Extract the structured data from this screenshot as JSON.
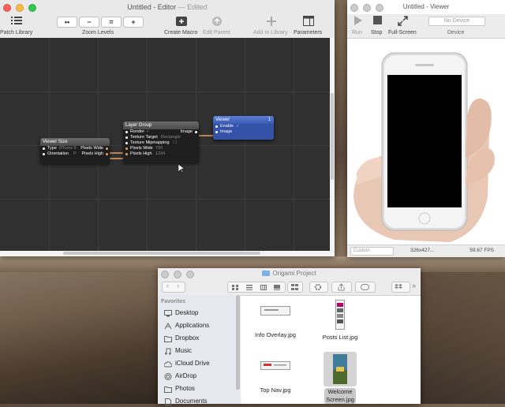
{
  "editor": {
    "title": "Untitled - Editor",
    "title_suffix": "— Edited",
    "toolbar": {
      "patch_library": "Patch Library",
      "zoom_buttons": [
        "••",
        "−",
        "=",
        "+"
      ],
      "zoom_levels": "Zoom Levels",
      "create_macro": "Create Macro",
      "edit_parent": "Edit Parent",
      "add_to_library": "Add to Library",
      "parameters": "Parameters"
    },
    "patches": {
      "viewer_size": {
        "title": "Viewer Size",
        "rows": [
          {
            "label": "Type",
            "value": "iPhone 6",
            "output": "Pixels Wide"
          },
          {
            "label": "Orientation",
            "value": "P",
            "output": "Pixels High"
          }
        ]
      },
      "layer_group": {
        "title": "Layer Group",
        "output": "Image",
        "rows": [
          {
            "label": "Render",
            "value": "✓"
          },
          {
            "label": "Texture Target",
            "value": "Rectangle"
          },
          {
            "label": "Texture Mipmapping",
            "value": "☐"
          },
          {
            "label": "Pixels Wide",
            "value": "750"
          },
          {
            "label": "Pixels High",
            "value": "1334"
          }
        ]
      },
      "viewer": {
        "title": "Viewer",
        "badge": "1",
        "rows": [
          {
            "label": "Enable",
            "value": "✓"
          },
          {
            "label": "Image",
            "value": ""
          }
        ]
      }
    }
  },
  "viewer_window": {
    "title": "Untitled - Viewer",
    "run": "Run",
    "stop": "Stop",
    "full_screen": "Full-Screen",
    "device_select": "No Device",
    "device_label": "Device",
    "size_select": "Custom",
    "dimensions": "326x427...",
    "fps": "59.67 FPS"
  },
  "finder": {
    "title": "Origami Project",
    "favorites_header": "Favorites",
    "sidebar": [
      "Desktop",
      "Applications",
      "Dropbox",
      "Music",
      "iCloud Drive",
      "AirDrop",
      "Photos",
      "Documents"
    ],
    "files": [
      {
        "name": "Info Overlay.jpg"
      },
      {
        "name": "Posts List.jpg"
      },
      {
        "name": "Top Nav.jpg"
      },
      {
        "name": "Welcome Screen.jpg",
        "selected": true
      }
    ]
  },
  "colors": {
    "accent_blue": "#3452a8",
    "wire_orange": "#e8a060",
    "canvas": "#303030"
  }
}
